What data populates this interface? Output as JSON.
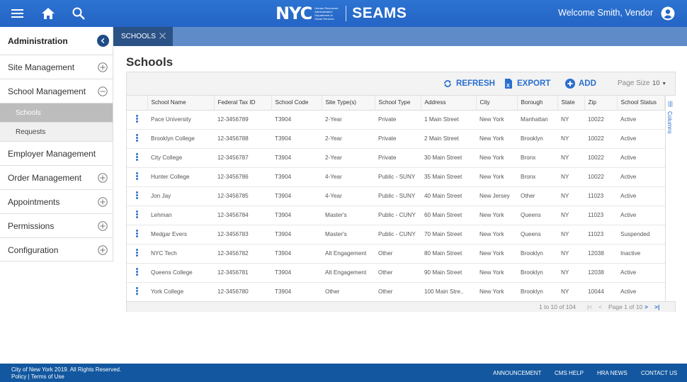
{
  "header": {
    "brand_logo": "NYC",
    "agency_lines": [
      "Human Resources",
      "Administration",
      "Department of",
      "Social Services"
    ],
    "app_name": "SEAMS",
    "welcome": "Welcome Smith, Vendor",
    "icons": [
      "menu-icon",
      "home-icon",
      "search-icon",
      "user-avatar-icon"
    ],
    "color": "#2c73d2"
  },
  "sidebar": {
    "title": "Administration",
    "items": [
      {
        "label": "Site Management",
        "icon": "plus-circle"
      },
      {
        "label": "School Management",
        "icon": "minus-circle",
        "expanded": true,
        "children": [
          {
            "label": "Schools",
            "active": true
          },
          {
            "label": "Requests"
          }
        ]
      },
      {
        "label": "Employer Management"
      },
      {
        "label": "Order Management",
        "icon": "plus-circle"
      },
      {
        "label": "Appointments",
        "icon": "plus-circle"
      },
      {
        "label": "Permissions",
        "icon": "plus-circle"
      },
      {
        "label": "Configuration",
        "icon": "plus-circle"
      }
    ]
  },
  "tabs": [
    {
      "label": "SCHOOLS"
    }
  ],
  "page": {
    "title": "Schools"
  },
  "toolbar": {
    "refresh": "REFRESH",
    "export": "EXPORT",
    "add": "ADD",
    "page_size_label": "Page Size",
    "page_size_value": "10"
  },
  "table": {
    "columns": [
      "School Name",
      "Federal Tax ID",
      "School Code",
      "Site Type(s)",
      "School Type",
      "Address",
      "City",
      "Borough",
      "State",
      "Zip",
      "School Status"
    ],
    "rows": [
      [
        "Pace University",
        "12-3456789",
        "T3904",
        "2-Year",
        "Private",
        "1 Main Street",
        "New York",
        "Manhattan",
        "NY",
        "10022",
        "Active"
      ],
      [
        "Brooklyn College",
        "12-3456788",
        "T3904",
        "2-Year",
        "Private",
        "2 Main Street",
        "New York",
        "Brooklyn",
        "NY",
        "10022",
        "Active"
      ],
      [
        "City College",
        "12-3456787",
        "T3904",
        "2-Year",
        "Private",
        "30 Main Street",
        "New York",
        "Bronx",
        "NY",
        "10022",
        "Active"
      ],
      [
        "Hunter College",
        "12-3456786",
        "T3904",
        "4-Year",
        "Public - SUNY",
        "35 Main Street",
        "New York",
        "Bronx",
        "NY",
        "10022",
        "Active"
      ],
      [
        "Jon Jay",
        "12-3456785",
        "T3904",
        "4-Year",
        "Public - SUNY",
        "40 Main Street",
        "New Jersey",
        "Other",
        "NY",
        "11023",
        "Active"
      ],
      [
        "Lehman",
        "12-3456784",
        "T3904",
        "Master's",
        "Public - CUNY",
        "60 Main Street",
        "New York",
        "Queens",
        "NY",
        "11023",
        "Active"
      ],
      [
        "Medgar Evers",
        "12-3456783",
        "T3904",
        "Master's",
        "Public - CUNY",
        "70 Main Street",
        "New York",
        "Queens",
        "NY",
        "11023",
        "Suspended"
      ],
      [
        "NYC Tech",
        "12-3456782",
        "T3904",
        "Alt Engagement",
        "Other",
        "80 Main Street",
        "New York",
        "Brooklyn",
        "NY",
        "12038",
        "Inactive"
      ],
      [
        "Queens College",
        "12-3456781",
        "T3904",
        "Alt Engagement",
        "Other",
        "90 Main Street",
        "New York",
        "Brooklyn",
        "NY",
        "12038",
        "Active"
      ],
      [
        "York College",
        "12-3456780",
        "T3904",
        "Other",
        "Other",
        "100 Main Stre..",
        "New York",
        "Brooklyn",
        "NY",
        "10044",
        "Active"
      ]
    ],
    "columns_panel_label": "Columns"
  },
  "pager": {
    "range": "1 to 10 of 104",
    "page": "Page 1 of 10"
  },
  "footer": {
    "copyright": "City of New York 2019. All Rights Reserved.",
    "policy": "Policy | Terms of Use",
    "links": [
      "ANNOUNCEMENT",
      "CMS HELP",
      "HRA NEWS",
      "CONTACT US"
    ]
  },
  "colors": {
    "accent": "#2a6fcf",
    "footer": "#12579f",
    "tab_active": "#2b5287",
    "tab_bar": "#5f8bc8"
  }
}
